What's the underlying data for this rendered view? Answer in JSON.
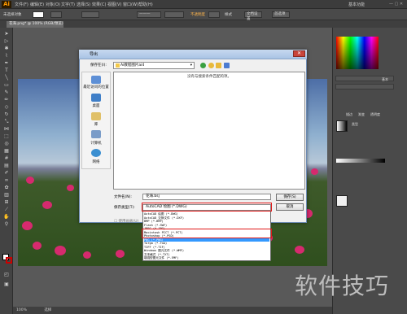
{
  "app": {
    "logo": "Ai"
  },
  "menubar": {
    "items": [
      "文件(F)",
      "编辑(E)",
      "对象(O)",
      "文字(T)",
      "选择(S)",
      "效果(C)",
      "视图(V)",
      "窗口(W)",
      "帮助(H)"
    ],
    "workspace": "基本功能"
  },
  "controlbar": {
    "selection_label": "未选择对象",
    "opacity_label": "不透明度",
    "style_label": "样式",
    "doc_setup": "文档设置",
    "prefs": "首选项"
  },
  "doc_tab": {
    "title": "花海.png* @ 100% (RGB/预览)"
  },
  "dialog": {
    "title": "导出",
    "save_in_label": "保存在(I):",
    "save_in_value": "Ai教程图片ai4",
    "empty_message": "没有与搜索条件匹配的项。",
    "places": [
      "最近访问的位置",
      "桌面",
      "库",
      "计算机",
      "网络"
    ],
    "filename_label": "文件名(N):",
    "filename_value": "花海.bsj",
    "filetype_label": "保存类型(T):",
    "filetype_value": "AutoCAD 绘图 (*.DWG)",
    "save_button": "保存(S)",
    "cancel_button": "取消",
    "use_artboards": "使用画板(U)",
    "filetype_options": [
      "AutoCAD 绘图 (*.DWG)",
      "AutoCAD 交换文件 (*.DXF)",
      "BMP (*.BMP)",
      "Flash (*.SWF)",
      "JPEG (*.JPG)",
      "Macintosh PICT (*.PCT)",
      "Photoshop (*.PSD)",
      "PNG (*.PNG)",
      "Targa (*.TGA)",
      "TIFF (*.TIF)",
      "Windows 图元文件 (*.WMF)",
      "文本格式 (*.TXT)",
      "增强型图元文件 (*.EMF)"
    ],
    "selected_option_index": 7
  },
  "right_panel": {
    "stroke_label": "基本",
    "tabs": [
      "描边",
      "渐变",
      "透明度"
    ],
    "gradient_type": "类型"
  },
  "statusbar": {
    "zoom": "100%",
    "mode": "选择"
  },
  "watermark": "软件技巧"
}
